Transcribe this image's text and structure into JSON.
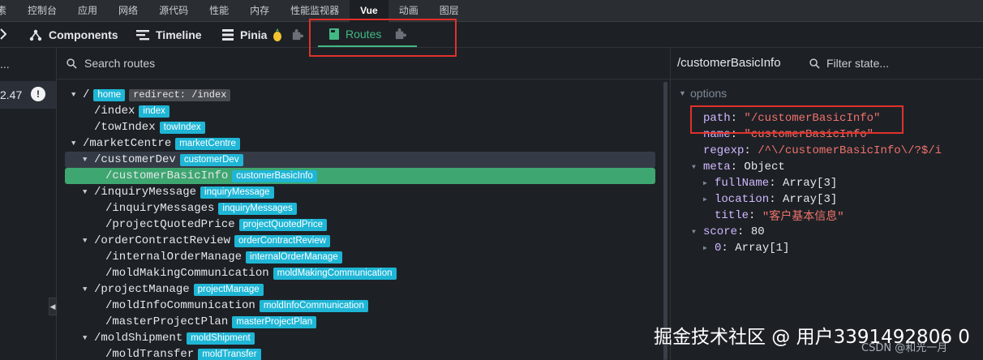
{
  "devtools_tabs": [
    {
      "label": "素"
    },
    {
      "label": "控制台"
    },
    {
      "label": "应用"
    },
    {
      "label": "网络"
    },
    {
      "label": "源代码"
    },
    {
      "label": "性能"
    },
    {
      "label": "内存"
    },
    {
      "label": "性能监视器"
    },
    {
      "label": "Vue",
      "active": true
    },
    {
      "label": "动画"
    },
    {
      "label": "图层"
    }
  ],
  "toolbar": {
    "components": "Components",
    "timeline": "Timeline",
    "pinia": "Pinia",
    "routes": "Routes"
  },
  "sidebar": {
    "ellipsis": "...",
    "version": "2.47",
    "warning": "!"
  },
  "search": {
    "placeholder": "Search routes"
  },
  "routes": [
    {
      "path": "/",
      "badges": [
        "home"
      ],
      "redirect": "redirect: /index",
      "arrow": "▼",
      "indent": 0
    },
    {
      "path": "/index",
      "badges": [
        "index"
      ],
      "arrow": "",
      "indent": 1
    },
    {
      "path": "/towIndex",
      "badges": [
        "towIndex"
      ],
      "arrow": "",
      "indent": 1
    },
    {
      "path": "/marketCentre",
      "badges": [
        "marketCentre"
      ],
      "arrow": "▼",
      "indent": 0
    },
    {
      "path": "/customerDev",
      "badges": [
        "customerDev"
      ],
      "arrow": "▼",
      "indent": 1,
      "state": "hover"
    },
    {
      "path": "/customerBasicInfo",
      "badges": [
        "customerBasicInfo"
      ],
      "arrow": "",
      "indent": 2,
      "state": "selected"
    },
    {
      "path": "/inquiryMessage",
      "badges": [
        "inquiryMessage"
      ],
      "arrow": "▼",
      "indent": 1
    },
    {
      "path": "/inquiryMessages",
      "badges": [
        "inquiryMessages"
      ],
      "arrow": "",
      "indent": 2
    },
    {
      "path": "/projectQuotedPrice",
      "badges": [
        "projectQuotedPrice"
      ],
      "arrow": "",
      "indent": 2
    },
    {
      "path": "/orderContractReview",
      "badges": [
        "orderContractReview"
      ],
      "arrow": "▼",
      "indent": 1
    },
    {
      "path": "/internalOrderManage",
      "badges": [
        "internalOrderManage"
      ],
      "arrow": "",
      "indent": 2
    },
    {
      "path": "/moldMakingCommunication",
      "badges": [
        "moldMakingCommunication"
      ],
      "arrow": "",
      "indent": 2
    },
    {
      "path": "/projectManage",
      "badges": [
        "projectManage"
      ],
      "arrow": "▼",
      "indent": 1
    },
    {
      "path": "/moldInfoCommunication",
      "badges": [
        "moldInfoCommunication"
      ],
      "arrow": "",
      "indent": 2
    },
    {
      "path": "/masterProjectPlan",
      "badges": [
        "masterProjectPlan"
      ],
      "arrow": "",
      "indent": 2
    },
    {
      "path": "/moldShipment",
      "badges": [
        "moldShipment"
      ],
      "arrow": "▼",
      "indent": 1
    },
    {
      "path": "/moldTransfer",
      "badges": [
        "moldTransfer"
      ],
      "arrow": "",
      "indent": 2
    }
  ],
  "state": {
    "title": "/customerBasicInfo",
    "filter_placeholder": "Filter state...",
    "section": "options",
    "rows": [
      {
        "arrow": "",
        "key": "path",
        "value": "\"/customerBasicInfo\"",
        "type": "s",
        "indent": 0
      },
      {
        "arrow": "",
        "key": "name",
        "value": "\"customerBasicInfo\"",
        "type": "s",
        "indent": 0
      },
      {
        "arrow": "",
        "key": "regexp",
        "value": "/^\\/customerBasicInfo\\/?$/i",
        "type": "s",
        "indent": 0
      },
      {
        "arrow": "▼",
        "key": "meta",
        "value": "Object",
        "type": "p",
        "indent": 0
      },
      {
        "arrow": "▶",
        "key": "fullName",
        "value": "Array[3]",
        "type": "p",
        "indent": 1
      },
      {
        "arrow": "▶",
        "key": "location",
        "value": "Array[3]",
        "type": "p",
        "indent": 1
      },
      {
        "arrow": "",
        "key": "title",
        "value": "\"客户基本信息\"",
        "type": "s",
        "indent": 1
      },
      {
        "arrow": "▼",
        "key": "score",
        "value": "80",
        "type": "n",
        "indent": 0
      },
      {
        "arrow": "▶",
        "key": "0",
        "value": "Array[1]",
        "type": "p",
        "indent": 1
      }
    ]
  },
  "watermark": {
    "main": "掘金技术社区 @ 用户3391492806 0",
    "sub": "CSDN @和光一月"
  },
  "colors": {
    "vue_green": "#42b883",
    "badge_cyan": "#1fb6d6",
    "selected_row": "#3ea670",
    "annotation_red": "#e0312b",
    "key_purple": "#d2b8ff",
    "string_red": "#f0726b"
  }
}
